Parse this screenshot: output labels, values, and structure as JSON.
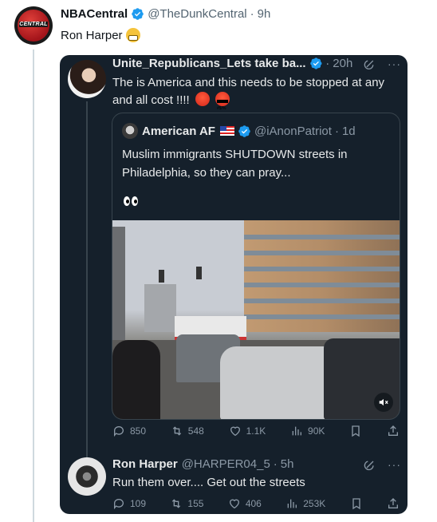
{
  "outer_tweet": {
    "display_name": "NBACentral",
    "handle": "@TheDunkCentral",
    "separator": "·",
    "time": "9h",
    "text": "Ron Harper",
    "avatar_text": "CENTRAL",
    "accent": "#1d9bf0"
  },
  "embedded_screenshot": {
    "tweet": {
      "display_name": "Unite_Republicans_Lets take ba...",
      "separator": "·",
      "time": "20h",
      "text": "The is America and this needs to be stopped at any and all cost !!!!",
      "more": "···"
    },
    "quote": {
      "display_name": "American AF",
      "handle": "@iAnonPatriot",
      "separator": "·",
      "time": "1d",
      "text": "Muslim immigrants SHUTDOWN streets in Philadelphia, so they can pray...",
      "media": "video"
    },
    "tweet_actions": {
      "replies": "850",
      "reposts": "548",
      "likes": "1.1K",
      "views": "90K"
    },
    "reply": {
      "display_name": "Ron Harper",
      "handle": "@HARPER04_5",
      "separator": "·",
      "time": "5h",
      "text": "Run them over.... Get out the streets",
      "more": "···"
    },
    "reply_actions": {
      "replies": "109",
      "reposts": "155",
      "likes": "406",
      "views": "253K"
    },
    "colors": {
      "background": "#15202b",
      "border": "#38444d",
      "text": "#e7e9ea",
      "muted": "#8b98a5",
      "verified": "#1d9bf0"
    }
  }
}
